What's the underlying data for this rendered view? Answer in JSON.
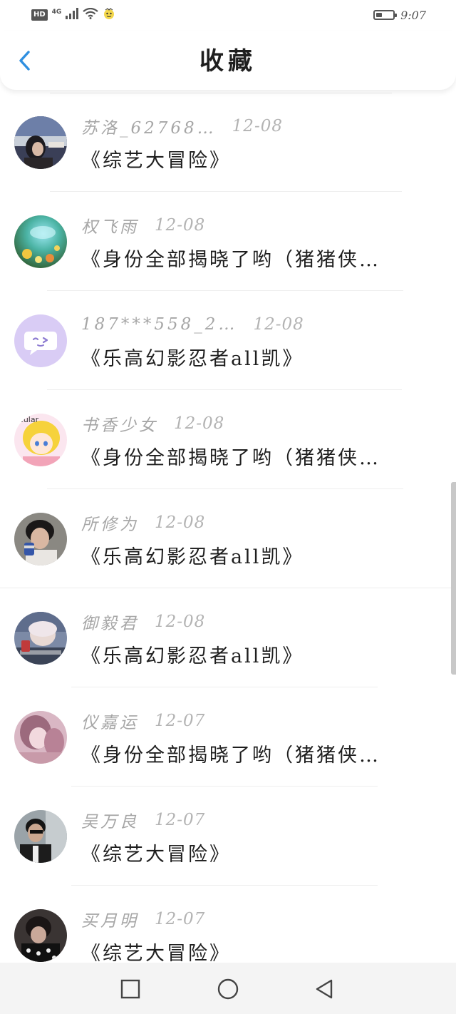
{
  "status_bar": {
    "hd": "HD",
    "network": "4G",
    "time": "9:07",
    "battery_level": 0.35
  },
  "header": {
    "title": "收藏"
  },
  "favorites": [
    {
      "author": "苏洛_62768…",
      "date": "12-08",
      "title": "《综艺大冒险》"
    },
    {
      "author": "权飞雨",
      "date": "12-08",
      "title": "《身份全部揭晓了哟（猪猪侠…"
    },
    {
      "author": "187***558_2…",
      "date": "12-08",
      "title": "《乐高幻影忍者all凯》"
    },
    {
      "author": "书香少女",
      "date": "12-08",
      "title": "《身份全部揭晓了哟（猪猪侠…"
    },
    {
      "author": "所修为",
      "date": "12-08",
      "title": "《乐高幻影忍者all凯》"
    },
    {
      "author": "御毅君",
      "date": "12-08",
      "title": "《乐高幻影忍者all凯》"
    },
    {
      "author": "仪嘉运",
      "date": "12-07",
      "title": "《身份全部揭晓了哟（猪猪侠…"
    },
    {
      "author": "吴万良",
      "date": "12-07",
      "title": "《综艺大冒险》"
    },
    {
      "author": "买月明",
      "date": "12-07",
      "title": "《综艺大冒险》"
    }
  ],
  "avatars": {
    "avatar_4_text": "ecular"
  },
  "colors": {
    "accent": "#2f8fe0",
    "meta_text": "#a6a6a6",
    "title_text": "#1e1e1e",
    "default_avatar_bg": "#d9ccf5"
  },
  "icons": {
    "back": "chevron-left-icon",
    "recent_apps": "square-icon",
    "home": "circle-icon",
    "back_nav": "triangle-left-icon"
  }
}
